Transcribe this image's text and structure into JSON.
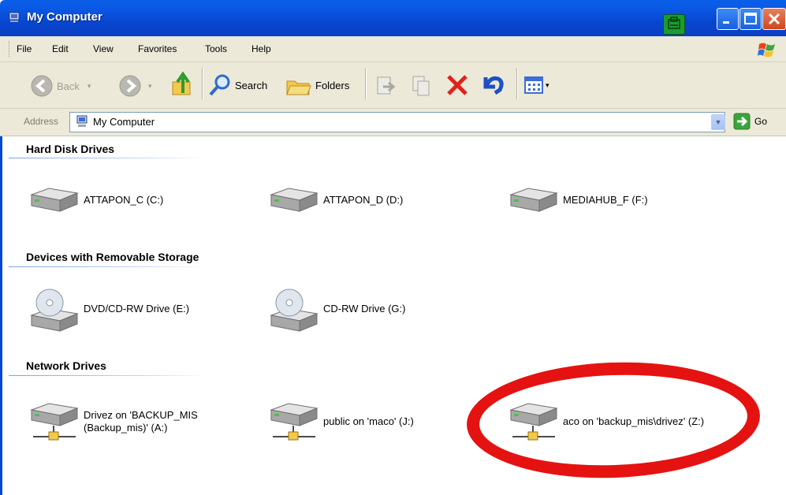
{
  "window": {
    "title": "My Computer"
  },
  "menu": [
    "File",
    "Edit",
    "View",
    "Favorites",
    "Tools",
    "Help"
  ],
  "toolbar": {
    "back_label": "Back",
    "search_label": "Search",
    "folders_label": "Folders"
  },
  "address": {
    "label": "Address",
    "value": "My Computer",
    "go_label": "Go"
  },
  "sections": {
    "hard": {
      "title": "Hard Disk Drives",
      "items": [
        {
          "label": "ATTAPON_C (C:)"
        },
        {
          "label": "ATTAPON_D (D:)"
        },
        {
          "label": "MEDIAHUB_F (F:)"
        }
      ]
    },
    "removable": {
      "title": "Devices with Removable Storage",
      "items": [
        {
          "label": "DVD/CD-RW Drive (E:)"
        },
        {
          "label": "CD-RW Drive (G:)"
        }
      ]
    },
    "network": {
      "title": "Network Drives",
      "items": [
        {
          "line1": "Drivez on 'BACKUP_MIS",
          "line2": "(Backup_mis)' (A:)"
        },
        {
          "label": "public on 'maco' (J:)"
        },
        {
          "label": "aco on 'backup_mis\\drivez' (Z:)"
        }
      ]
    }
  },
  "colors": {
    "titlebar": "#0847d0",
    "annotation_ring": "#e51212",
    "toolbar_bg": "#ece9d8"
  }
}
